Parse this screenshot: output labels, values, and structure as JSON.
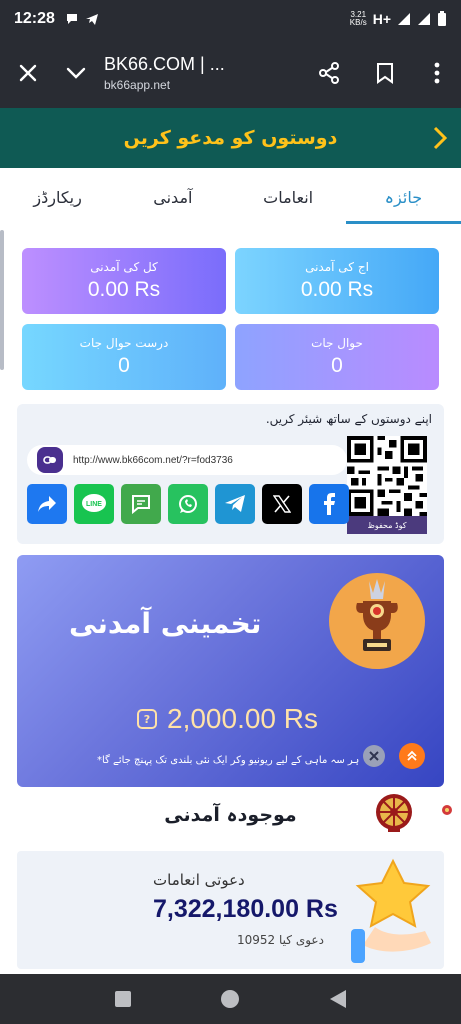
{
  "status_bar": {
    "time": "12:28",
    "speed_top": "3.21",
    "speed_bottom": "KB/s",
    "network": "H+"
  },
  "browser": {
    "title": "BK66.COM | ...",
    "url": "bk66app.net"
  },
  "invite_banner": {
    "text": "دوستوں کو مدعو کریں"
  },
  "tabs": [
    {
      "label": "ریکارڈز",
      "active": false
    },
    {
      "label": "آمدنی",
      "active": false
    },
    {
      "label": "انعامات",
      "active": false
    },
    {
      "label": "جائزہ",
      "active": true
    }
  ],
  "stats": {
    "total_earnings": {
      "label": "کل کی آمدنی",
      "value": "0.00 Rs"
    },
    "today_earnings": {
      "label": "اج کی آمدنی",
      "value": "0.00 Rs"
    },
    "valid_referrals": {
      "label": "درست حوال جات",
      "value": "0"
    },
    "referrals": {
      "label": "حوال جات",
      "value": "0"
    }
  },
  "share": {
    "title": "اپنے دوستوں کے ساتھ شیئر کریں.",
    "link": "http://www.bk66com.net/?r=fod3736",
    "qr_label": "کوڈ محفوظ",
    "social_icons": [
      "share-icon",
      "line-icon",
      "message-icon",
      "whatsapp-icon",
      "telegram-icon",
      "x-icon",
      "facebook-icon"
    ],
    "icon_colors": [
      "#1e78f0",
      "#18c450",
      "#41a94c",
      "#27c25f",
      "#1f95d3",
      "#000000",
      "#1774eb"
    ]
  },
  "estimate": {
    "title": "تخمینی آمدنی",
    "amount": "2,000.00 Rs",
    "note": "ہر سہ ماہی کے لیے ریونیو وکر ایک نئی بلندی تک پہنچ جائے گا*"
  },
  "current": {
    "title": "موجودہ آمدنی"
  },
  "invite_rewards": {
    "label": "دعوتی انعامات",
    "amount": "7,322,180.00 Rs",
    "count": "10952",
    "count_suffix": "دعوی کیا"
  },
  "colors": {
    "banner_bg": "#0f5a54",
    "banner_text": "#ffc21a",
    "tab_active": "#2a8fc7",
    "amount_color": "#15186a"
  }
}
